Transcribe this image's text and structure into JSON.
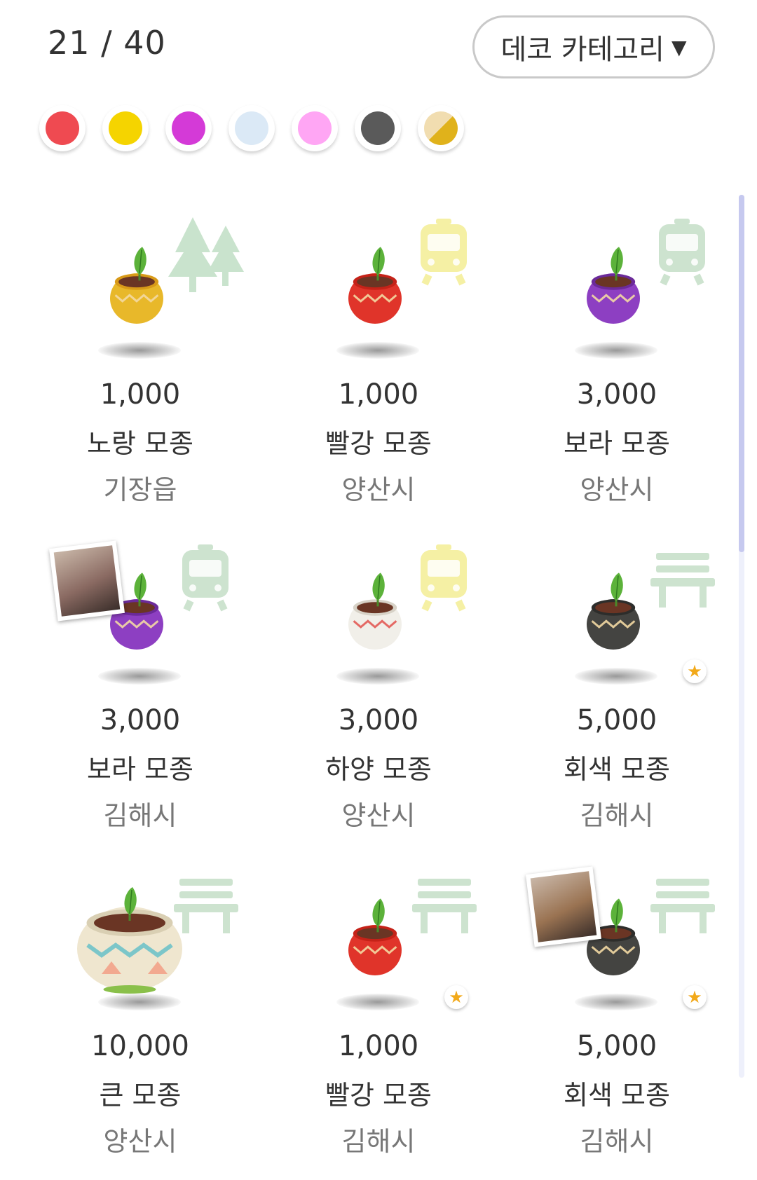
{
  "header": {
    "counter": "21 / 40",
    "category_label": "데코 카테고리",
    "category_arrow": "▼"
  },
  "color_filters": [
    {
      "name": "red",
      "color": "#ef4a51"
    },
    {
      "name": "yellow",
      "color": "#f5d400"
    },
    {
      "name": "purple",
      "color": "#d43ad7"
    },
    {
      "name": "light-blue",
      "color": "#dbe9f6"
    },
    {
      "name": "pink",
      "color": "#ffa6f4"
    },
    {
      "name": "gray",
      "color": "#5a5a5a"
    },
    {
      "name": "mixed",
      "color": "#e0b21b"
    }
  ],
  "items": [
    {
      "price": "1,000",
      "name": "노랑 모종",
      "location": "기장읍",
      "pot_color": "#e8b82a",
      "rim_color": "#d89a18",
      "icon": "tree-icon",
      "icon_color": "#c9e3cd",
      "star": false,
      "photo": false
    },
    {
      "price": "1,000",
      "name": "빨강 모종",
      "location": "양산시",
      "pot_color": "#e0342a",
      "rim_color": "#c52218",
      "icon": "train-icon",
      "icon_color": "#f5f0a4",
      "star": false,
      "photo": false
    },
    {
      "price": "3,000",
      "name": "보라 모종",
      "location": "양산시",
      "pot_color": "#8d3fc2",
      "rim_color": "#6b2a9a",
      "icon": "train-icon",
      "icon_color": "#cde3cf",
      "star": false,
      "photo": false
    },
    {
      "price": "3,000",
      "name": "보라 모종",
      "location": "김해시",
      "pot_color": "#8d3fc2",
      "rim_color": "#6b2a9a",
      "icon": "train-icon",
      "icon_color": "#cde3cf",
      "star": false,
      "photo": true,
      "photo_color": "#8a6a62"
    },
    {
      "price": "3,000",
      "name": "하양 모종",
      "location": "양산시",
      "pot_color": "#f1efe9",
      "rim_color": "#d7d2c7",
      "icon": "train-icon",
      "icon_color": "#f5f0a4",
      "star": false,
      "photo": false
    },
    {
      "price": "5,000",
      "name": "회색 모종",
      "location": "김해시",
      "pot_color": "#444441",
      "rim_color": "#2d2d2b",
      "icon": "bench-icon",
      "icon_color": "#cde3cf",
      "star": true,
      "photo": false
    },
    {
      "price": "10,000",
      "name": "큰 모종",
      "location": "양산시",
      "pot_color": "#efe6cf",
      "rim_color": "#d9cfb3",
      "icon": "bench-icon",
      "icon_color": "#cde3cf",
      "star": false,
      "photo": false,
      "big": true
    },
    {
      "price": "1,000",
      "name": "빨강 모종",
      "location": "김해시",
      "pot_color": "#e0342a",
      "rim_color": "#c52218",
      "icon": "bench-icon",
      "icon_color": "#cde3cf",
      "star": true,
      "photo": false
    },
    {
      "price": "5,000",
      "name": "회색 모종",
      "location": "김해시",
      "pot_color": "#444441",
      "rim_color": "#2d2d2b",
      "icon": "bench-icon",
      "icon_color": "#cde3cf",
      "star": true,
      "photo": true,
      "photo_color": "#9a7352"
    }
  ]
}
